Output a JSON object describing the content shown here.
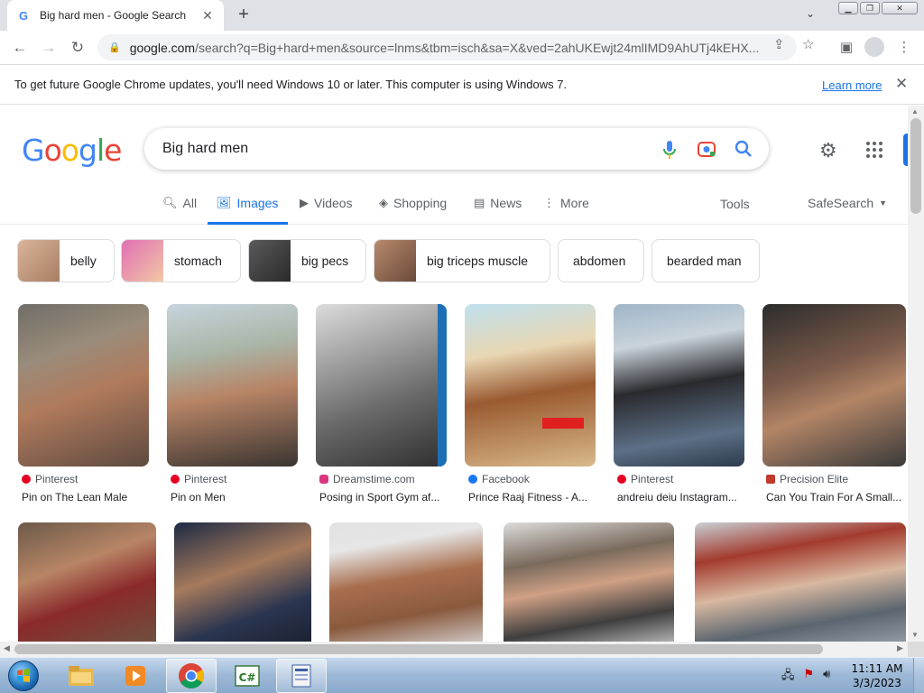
{
  "browser": {
    "tab_title": "Big hard men - Google Search",
    "url_host": "google.com",
    "url_rest": "/search?q=Big+hard+men&source=lnms&tbm=isch&sa=X&ved=2ahUKEwjt24mlIMD9AhUTj4kEHX..."
  },
  "infobar": {
    "message": "To get future Google Chrome updates, you'll need Windows 10 or later. This computer is using Windows 7.",
    "link": "Learn more"
  },
  "search": {
    "logo": [
      "G",
      "o",
      "o",
      "g",
      "l",
      "e"
    ],
    "query": "Big hard men"
  },
  "tabs": {
    "all": "All",
    "images": "Images",
    "videos": "Videos",
    "shopping": "Shopping",
    "news": "News",
    "more": "More",
    "tools": "Tools",
    "safesearch": "SafeSearch"
  },
  "chips": [
    "belly",
    "stomach",
    "big pecs",
    "big triceps muscle",
    "abdomen",
    "bearded man"
  ],
  "results_row1": [
    {
      "source": "Pinterest",
      "title": "Pin on The Lean Male",
      "source_color": "#e60023"
    },
    {
      "source": "Pinterest",
      "title": "Pin on Men",
      "source_color": "#e60023"
    },
    {
      "source": "Dreamstime.com",
      "title": "Posing in Sport Gym af...",
      "source_color": "#d9367f"
    },
    {
      "source": "Facebook",
      "title": "Prince Raaj Fitness - A...",
      "source_color": "#1877f2"
    },
    {
      "source": "Pinterest",
      "title": "andreiu deiu Instagram...",
      "source_color": "#e60023"
    },
    {
      "source": "Precision Elite",
      "title": "Can You Train For A Small...",
      "source_color": "#c0392b"
    }
  ],
  "taskbar": {
    "time": "11:11 AM",
    "date": "3/3/2023"
  }
}
